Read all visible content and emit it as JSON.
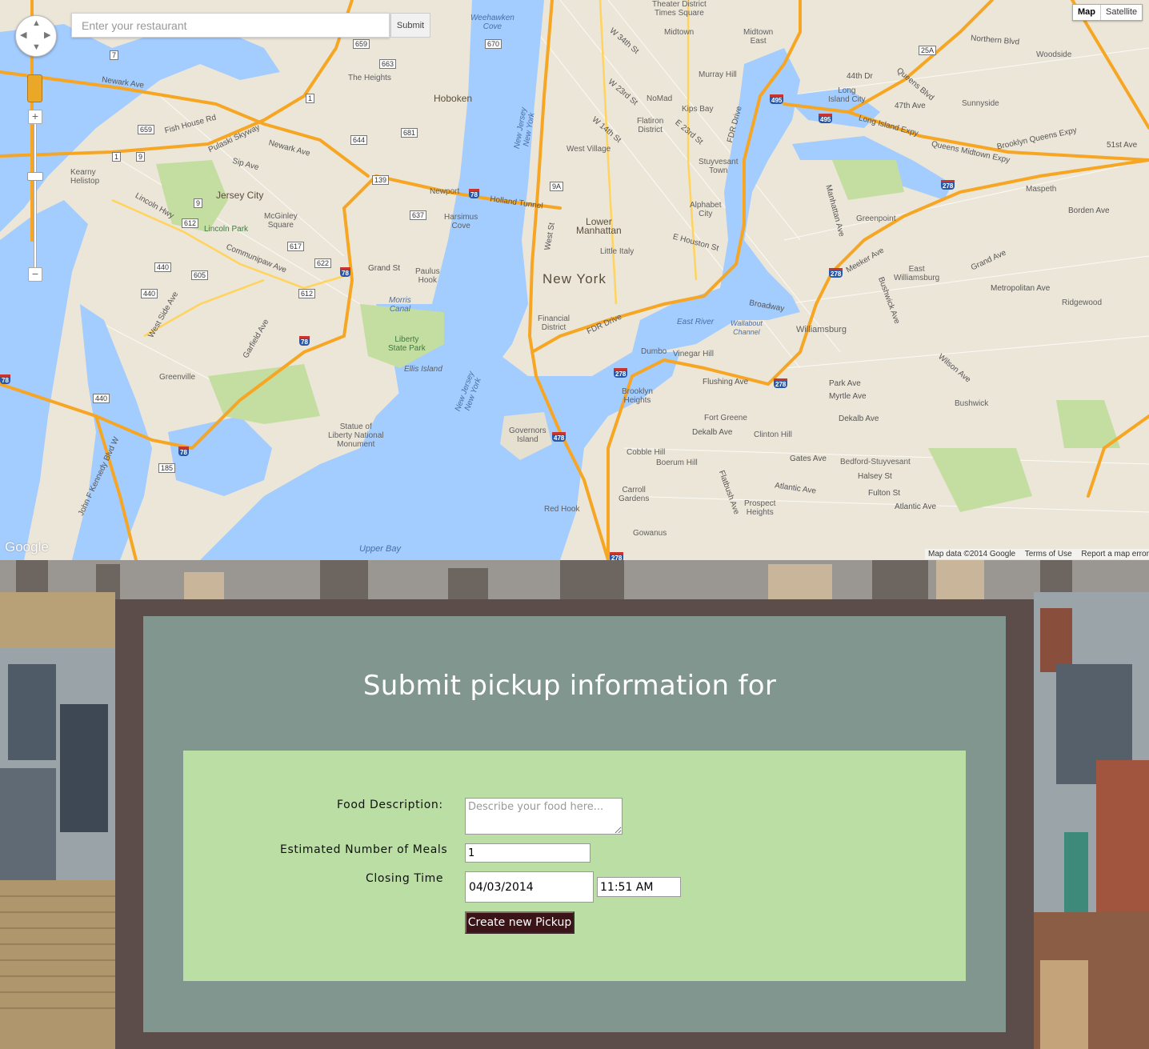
{
  "map": {
    "search": {
      "placeholder": "Enter your restaurant",
      "submit_label": "Submit"
    },
    "map_type": {
      "map_label": "Map",
      "satellite_label": "Satellite",
      "selected": "Map"
    },
    "logo_text": "Google",
    "footer": {
      "attribution": "Map data ©2014 Google",
      "terms": "Terms of Use",
      "report": "Report a map error"
    },
    "icons": [
      "pan-control-icon",
      "pegman-icon",
      "zoom-in-icon",
      "zoom-out-icon"
    ],
    "place_labels": {
      "new_york": "New York",
      "jersey_city": "Jersey City",
      "hoboken": "Hoboken",
      "lower_manhattan": "Lower\nManhattan",
      "williamsburg": "Williamsburg",
      "east_williamsburg": "East\nWilliamsburg",
      "greenpoint": "Greenpoint",
      "long_island_city": "Long\nIsland City",
      "brooklyn_heights": "Brooklyn\nHeights",
      "dumbo": "Dumbo",
      "vinegar_hill": "Vinegar Hill",
      "fort_greene": "Fort Greene",
      "clinton_hill": "Clinton Hill",
      "bedford_stuyvesant": "Bedford-Stuyvesant",
      "cobble_hill": "Cobble Hill",
      "boerum_hill": "Boerum Hill",
      "carroll_gardens": "Carroll\nGardens",
      "red_hook": "Red Hook",
      "gowanus": "Gowanus",
      "prospect_heights": "Prospect\nHeights",
      "bushwick": "Bushwick",
      "ridgewood": "Ridgewood",
      "maspeth": "Maspeth",
      "woodside": "Woodside",
      "sunnyside": "Sunnyside",
      "financial_district": "Financial\nDistrict",
      "little_italy": "Little Italy",
      "alphabet_city": "Alphabet\nCity",
      "stuyvesant_town": "Stuyvesant\nTown",
      "kips_bay": "Kips Bay",
      "murray_hill": "Murray Hill",
      "midtown": "Midtown",
      "midtown_east": "Midtown\nEast",
      "nomad": "NoMad",
      "flatiron": "Flatiron\nDistrict",
      "west_village": "West Village",
      "the_heights": "The Heights",
      "mcginley_square": "McGinley\nSquare",
      "lincoln_park": "Lincoln Park",
      "greenville": "Greenville",
      "paulus_hook": "Paulus\nHook",
      "newport": "Newport",
      "harsimus_cove": "Harsimus\nCove",
      "weehawken_cove": "Weehawken\nCove",
      "kearny_heliport": "Kearny\nHelistop",
      "theater_district": "Theater District\nTimes Square",
      "liberty_state_park": "Liberty\nState Park",
      "statue_of_liberty": "Statue of\nLiberty National\nMonument",
      "ellis_island": "Ellis Island",
      "governors_island": "Governors\nIsland",
      "morris_canal": "Morris\nCanal",
      "upper_bay": "Upper Bay",
      "east_river": "East River",
      "wallabout_channel": "Wallabout\nChannel",
      "new_jersey_new_york": "New Jersey\nNew York"
    },
    "road_labels": {
      "newark_ave": "Newark Ave",
      "pulaski_skyway": "Pulaski Skyway",
      "fish_house_rd": "Fish House Rd",
      "sip_ave": "Sip Ave",
      "lincoln_hwy": "Lincoln Hwy",
      "communipaw_ave": "Communipaw Ave",
      "west_side_ave": "West Side Ave",
      "jfk_blvd": "John F Kennedy Blvd W",
      "garfield_ave": "Garfield Ave",
      "grand_st": "Grand St",
      "holland_tunnel": "Holland Tunnel",
      "west_st": "West St",
      "fdr_drive": "FDR Drive",
      "broadway": "Broadway",
      "e_houston_st": "E Houston St",
      "flushing_ave": "Flushing Ave",
      "atlantic_ave": "Atlantic Ave",
      "fulton_st": "Fulton St",
      "long_island_expy": "Long Island Expy",
      "queens_midtown_expy": "Queens Midtown Expy",
      "brooklyn_queens_expy": "Brooklyn Queens Expy",
      "queens_blvd": "Queens Blvd",
      "northern_blvd": "Northern Blvd",
      "metropolitan_ave": "Metropolitan Ave",
      "meeker_ave": "Meeker Ave",
      "myrtle_ave": "Myrtle Ave",
      "dekalb_ave": "Dekalb Ave",
      "gates_ave": "Gates Ave",
      "halsey_st": "Halsey St",
      "park_ave": "Park Ave",
      "flatbush_ave": "Flatbush Ave",
      "manhattan_ave": "Manhattan Ave",
      "w_34th_st": "W 34th St",
      "w_23rd_st": "W 23rd St",
      "w_14th_st": "W 14th St",
      "e_23rd_st": "E 23rd St",
      "borden_ave": "Borden Ave",
      "47th_ave": "47th Ave",
      "44th_dr": "44th Dr",
      "51st_ave": "51st Ave",
      "grand_ave": "Grand Ave",
      "bushwick_ave": "Bushwick Ave",
      "wilson_ave": "Wilson Ave"
    },
    "route_shields": [
      "495",
      "278",
      "478",
      "78",
      "9A",
      "1",
      "9",
      "7",
      "139",
      "440",
      "185",
      "612",
      "617",
      "622",
      "605",
      "637",
      "644",
      "659",
      "663",
      "670",
      "681",
      "25A"
    ]
  },
  "form": {
    "title": "Submit pickup information for",
    "food_description": {
      "label": "Food Description:",
      "placeholder": "Describe your food here...",
      "value": ""
    },
    "meals": {
      "label": "Estimated Number of Meals",
      "value": "1"
    },
    "closing_time": {
      "label": "Closing Time",
      "date": "04/03/2014",
      "time": "11:51 AM"
    },
    "submit_label": "Create new Pickup"
  },
  "colors": {
    "map_land": "#ece6d8",
    "map_water": "#a3ccff",
    "map_park": "#c4dda0",
    "highway": "#f6a623",
    "outer_panel": "#5c4d4a",
    "inner_panel": "#80968f",
    "form_box": "#bbdea4",
    "button": "#3a1416"
  }
}
